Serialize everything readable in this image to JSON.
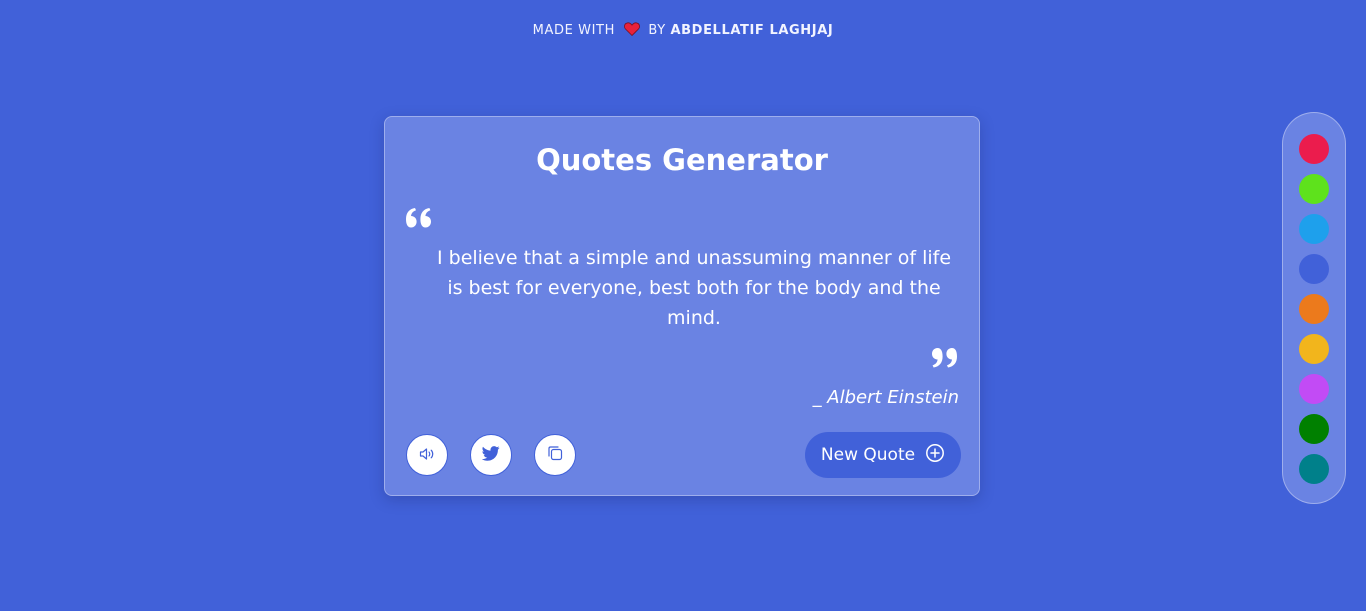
{
  "credit": {
    "prefix": "MADE WITH",
    "by": "BY",
    "author": "ABDELLATIF LAGHJAJ",
    "icon": "heart-icon",
    "heart_color": "#e8213a"
  },
  "card": {
    "title": "Quotes Generator",
    "quote": "I believe that a simple and unassuming manner of life is best for everyone, best both for the body and the mind.",
    "author": "_ Albert Einstein",
    "open_quote_icon": "quote-left-icon",
    "close_quote_icon": "quote-right-icon"
  },
  "actions": {
    "speech_icon": "volume-icon",
    "twitter_icon": "twitter-icon",
    "copy_icon": "copy-icon",
    "new_quote_label": "New Quote",
    "new_quote_icon": "plus-circle-icon"
  },
  "theme": {
    "background": "#4161d9",
    "card": "#6a83e3"
  },
  "palette": [
    {
      "name": "crimson",
      "color": "#eb1c4d"
    },
    {
      "name": "lime",
      "color": "#5ee21c"
    },
    {
      "name": "sky",
      "color": "#1ea0ec"
    },
    {
      "name": "royal",
      "color": "#4161d9"
    },
    {
      "name": "orange",
      "color": "#ec7a1c"
    },
    {
      "name": "amber",
      "color": "#f2b51c"
    },
    {
      "name": "violet",
      "color": "#c24bf5"
    },
    {
      "name": "green",
      "color": "#008000"
    },
    {
      "name": "teal",
      "color": "#00808a"
    }
  ]
}
